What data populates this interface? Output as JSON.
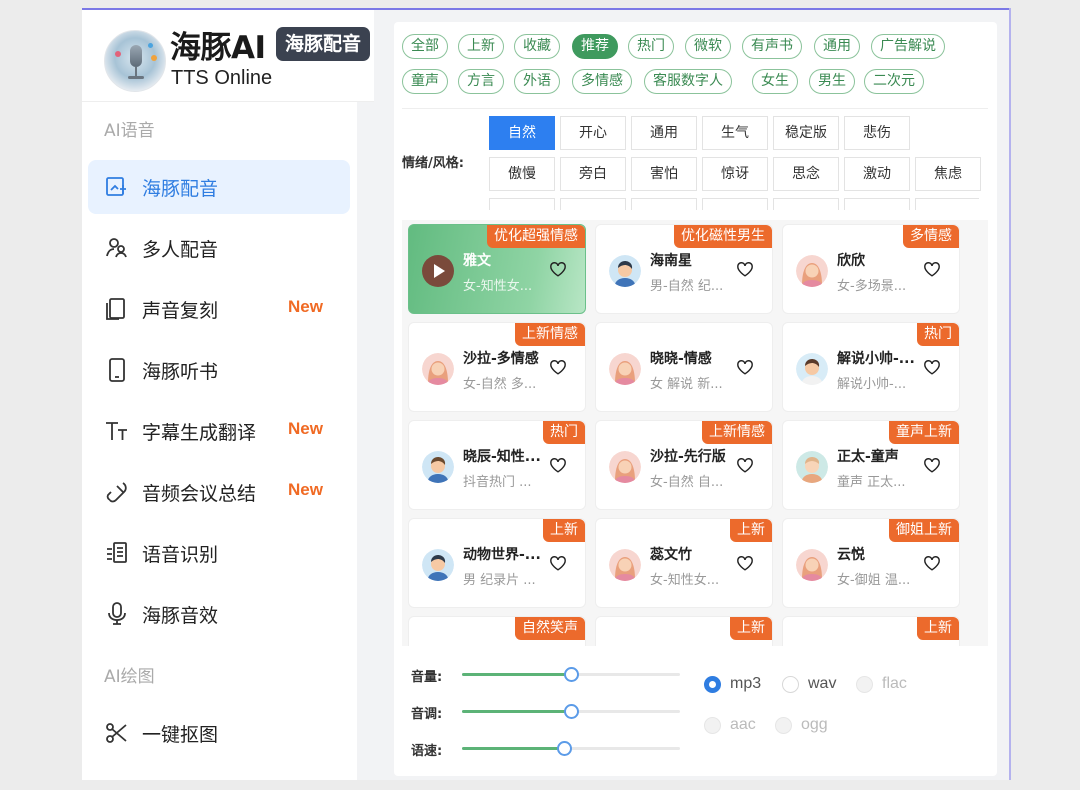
{
  "brand": {
    "title": "海豚AI",
    "badge": "海豚配音",
    "subtitle": "TTS Online"
  },
  "sidebar": {
    "section_voice": "AI语音",
    "section_draw": "AI绘图",
    "items": [
      {
        "label": "海豚配音",
        "icon": "voice-image-icon",
        "active": true,
        "new": ""
      },
      {
        "label": "多人配音",
        "icon": "multi-user-icon",
        "new": ""
      },
      {
        "label": "声音复刻",
        "icon": "copy-icon",
        "new": "New"
      },
      {
        "label": "海豚听书",
        "icon": "phone-icon",
        "new": ""
      },
      {
        "label": "字幕生成翻译",
        "icon": "text-size-icon",
        "new": "New"
      },
      {
        "label": "音频会议总结",
        "icon": "headset-icon",
        "new": "New"
      },
      {
        "label": "语音识别",
        "icon": "recognize-icon",
        "new": ""
      },
      {
        "label": "海豚音效",
        "icon": "microphone-icon",
        "new": ""
      },
      {
        "label": "一键抠图",
        "icon": "scissors-icon",
        "new": ""
      }
    ]
  },
  "tags": {
    "row1": [
      "全部",
      "上新",
      "收藏",
      "推荐",
      "热门",
      "微软",
      "有声书",
      "通用",
      "广告解说"
    ],
    "row2": [
      "童声",
      "方言",
      "外语",
      "多情感",
      "客服数字人",
      "女生",
      "男生",
      "二次元"
    ],
    "active": "推荐"
  },
  "styles": {
    "label": "情绪/风格:",
    "row1": [
      "自然",
      "开心",
      "通用",
      "生气",
      "稳定版",
      "悲伤"
    ],
    "row2": [
      "傲慢",
      "旁白",
      "害怕",
      "惊讶",
      "思念",
      "激动",
      "焦虑"
    ],
    "active": "自然"
  },
  "voices": [
    {
      "name": "雅文",
      "desc": "女-知性女...",
      "badge": "优化超强情感",
      "selected": true
    },
    {
      "name": "海南星",
      "desc": "男-自然 纪...",
      "badge": "优化磁性男生",
      "avatar": "male"
    },
    {
      "name": "欣欣",
      "desc": "女-多场景...",
      "badge": "多情感",
      "avatar": "female"
    },
    {
      "name": "沙拉-多情感",
      "desc": "女-自然 多...",
      "badge": "上新情感",
      "avatar": "female"
    },
    {
      "name": "晓晓-情感",
      "desc": "女 解说 新...",
      "badge": "",
      "avatar": "female"
    },
    {
      "name": "解说小帅-...",
      "desc": "解说小帅-...",
      "badge": "热门",
      "avatar": "male"
    },
    {
      "name": "晓辰-知性...",
      "desc": "抖音热门 ...",
      "badge": "热门",
      "avatar": "male"
    },
    {
      "name": "沙拉-先行版",
      "desc": "女-自然 自...",
      "badge": "上新情感",
      "avatar": "female"
    },
    {
      "name": "正太-童声",
      "desc": "童声 正太...",
      "badge": "童声上新",
      "avatar": "child"
    },
    {
      "name": "动物世界-...",
      "desc": "男 纪录片 ...",
      "badge": "上新",
      "avatar": "male"
    },
    {
      "name": "蕊文竹",
      "desc": "女-知性女...",
      "badge": "上新",
      "avatar": "female"
    },
    {
      "name": "云悦",
      "desc": "女-御姐 温...",
      "badge": "御姐上新",
      "avatar": "female"
    },
    {
      "name": "",
      "desc": "",
      "badge": "自然笑声"
    },
    {
      "name": "",
      "desc": "",
      "badge": "上新"
    },
    {
      "name": "",
      "desc": "",
      "badge": "上新"
    }
  ],
  "controls": {
    "volume": {
      "label": "音量:",
      "value": 0.5
    },
    "pitch": {
      "label": "音调:",
      "value": 0.5
    },
    "speed": {
      "label": "语速:",
      "value": 0.47
    }
  },
  "formats": [
    {
      "label": "mp3",
      "checked": true,
      "disabled": false
    },
    {
      "label": "wav",
      "checked": false,
      "disabled": false
    },
    {
      "label": "flac",
      "checked": false,
      "disabled": true
    },
    {
      "label": "aac",
      "checked": false,
      "disabled": true
    },
    {
      "label": "ogg",
      "checked": false,
      "disabled": true
    }
  ],
  "colors": {
    "accent_green": "#3f9a5e",
    "accent_blue": "#2f7de1",
    "badge_orange": "#ec6a2c",
    "new_orange": "#f06a24"
  }
}
